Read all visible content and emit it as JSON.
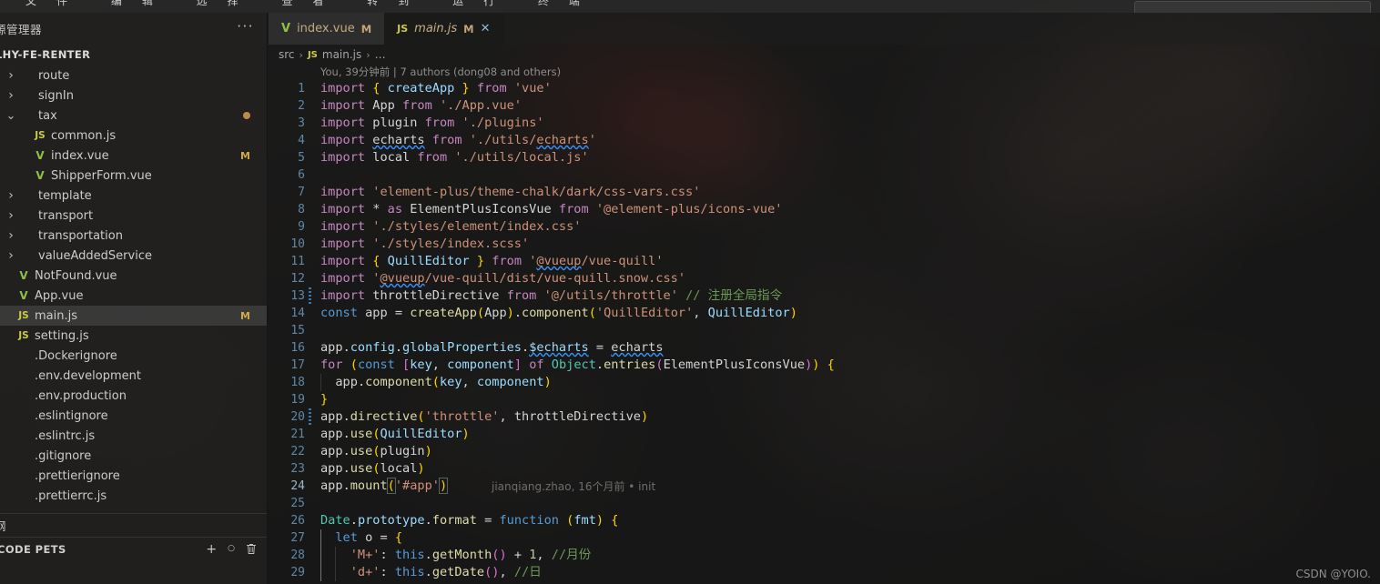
{
  "menubar": {
    "items_cropped": "文件 编辑 选择 查看 转到 运行 终端",
    "search_placeholder": ""
  },
  "sidebar": {
    "title": "源管理器",
    "more_icon": "ellipsis-icon",
    "project": "LHY-FE-RENTER",
    "tree": [
      {
        "label": "route",
        "depth": 1,
        "kind": "folder",
        "chev": "›",
        "icon": "",
        "badge": ""
      },
      {
        "label": "signIn",
        "depth": 1,
        "kind": "folder",
        "chev": "›",
        "icon": "",
        "badge": ""
      },
      {
        "label": "tax",
        "depth": 1,
        "kind": "folder",
        "chev": "⌄",
        "icon": "",
        "badge": "dot"
      },
      {
        "label": "common.js",
        "depth": 2,
        "kind": "js",
        "chev": "",
        "icon": "JS",
        "badge": ""
      },
      {
        "label": "index.vue",
        "depth": 2,
        "kind": "vue",
        "chev": "",
        "icon": "V",
        "badge": "M"
      },
      {
        "label": "ShipperForm.vue",
        "depth": 2,
        "kind": "vue",
        "chev": "",
        "icon": "V",
        "badge": ""
      },
      {
        "label": "template",
        "depth": 1,
        "kind": "folder",
        "chev": "›",
        "icon": "",
        "badge": ""
      },
      {
        "label": "transport",
        "depth": 1,
        "kind": "folder",
        "chev": "›",
        "icon": "",
        "badge": ""
      },
      {
        "label": "transportation",
        "depth": 1,
        "kind": "folder",
        "chev": "›",
        "icon": "",
        "badge": ""
      },
      {
        "label": "valueAddedService",
        "depth": 1,
        "kind": "folder",
        "chev": "›",
        "icon": "",
        "badge": ""
      },
      {
        "label": "NotFound.vue",
        "depth": 0,
        "kind": "vue",
        "chev": "",
        "icon": "V",
        "badge": ""
      },
      {
        "label": "App.vue",
        "depth": 0,
        "kind": "vue",
        "chev": "",
        "icon": "V",
        "badge": ""
      },
      {
        "label": "main.js",
        "depth": 0,
        "kind": "js",
        "chev": "",
        "icon": "JS",
        "badge": "M",
        "selected": true
      },
      {
        "label": "setting.js",
        "depth": 0,
        "kind": "js",
        "chev": "",
        "icon": "JS",
        "badge": ""
      },
      {
        "label": ".Dockerignore",
        "depth": 0,
        "kind": "cfg",
        "chev": "",
        "icon": "",
        "badge": ""
      },
      {
        "label": ".env.development",
        "depth": 0,
        "kind": "cfg",
        "chev": "",
        "icon": "",
        "badge": ""
      },
      {
        "label": ".env.production",
        "depth": 0,
        "kind": "cfg",
        "chev": "",
        "icon": "",
        "badge": ""
      },
      {
        "label": ".eslintignore",
        "depth": 0,
        "kind": "cfg",
        "chev": "",
        "icon": "",
        "badge": ""
      },
      {
        "label": ".eslintrc.js",
        "depth": 0,
        "kind": "cfg",
        "chev": "",
        "icon": "",
        "badge": ""
      },
      {
        "label": ".gitignore",
        "depth": 0,
        "kind": "cfg",
        "chev": "",
        "icon": "",
        "badge": ""
      },
      {
        "label": ".prettierignore",
        "depth": 0,
        "kind": "cfg",
        "chev": "",
        "icon": "",
        "badge": ""
      },
      {
        "label": ".prettierrc.js",
        "depth": 0,
        "kind": "cfg",
        "chev": "",
        "icon": "",
        "badge": ""
      }
    ],
    "outline_panel": {
      "title": "纲"
    },
    "codepets_panel": {
      "title": "CODE PETS",
      "actions": [
        "plus-icon",
        "circle-icon",
        "trash-icon"
      ],
      "action_glyphs": [
        "+",
        "○",
        "🗑"
      ]
    }
  },
  "editor": {
    "tabs": [
      {
        "name": "index.vue",
        "icon": "vue-file-icon",
        "icon_glyph": "V",
        "dirty": "M",
        "state": "inactive",
        "preview": false,
        "closable": false
      },
      {
        "name": "main.js",
        "icon": "js-file-icon",
        "icon_glyph": "JS",
        "dirty": "M",
        "state": "active",
        "preview": true,
        "closable": true,
        "close_glyph": "✕"
      }
    ],
    "breadcrumb": [
      {
        "text": "src",
        "icon": ""
      },
      {
        "text": "main.js",
        "icon": "JS"
      },
      {
        "text": "…",
        "icon": ""
      }
    ],
    "breadcrumb_sep": "›",
    "blame_header": "You, 39分钟前 | 7 authors (dong08 and others)",
    "inline_blame": "jianqiang.zhao, 16个月前 • init",
    "lines": [
      {
        "n": "1",
        "mod": false
      },
      {
        "n": "2",
        "mod": false
      },
      {
        "n": "3",
        "mod": false
      },
      {
        "n": "4",
        "mod": false
      },
      {
        "n": "5",
        "mod": false
      },
      {
        "n": "6",
        "mod": false
      },
      {
        "n": "7",
        "mod": false
      },
      {
        "n": "8",
        "mod": false
      },
      {
        "n": "9",
        "mod": false
      },
      {
        "n": "10",
        "mod": false
      },
      {
        "n": "11",
        "mod": false
      },
      {
        "n": "12",
        "mod": false
      },
      {
        "n": "13",
        "mod": true
      },
      {
        "n": "14",
        "mod": false
      },
      {
        "n": "15",
        "mod": false
      },
      {
        "n": "16",
        "mod": false
      },
      {
        "n": "17",
        "mod": false
      },
      {
        "n": "18",
        "mod": false
      },
      {
        "n": "19",
        "mod": false
      },
      {
        "n": "20",
        "mod": true
      },
      {
        "n": "21",
        "mod": false
      },
      {
        "n": "22",
        "mod": false
      },
      {
        "n": "23",
        "mod": false
      },
      {
        "n": "24",
        "mod": false
      },
      {
        "n": "25",
        "mod": false
      },
      {
        "n": "26",
        "mod": false
      },
      {
        "n": "27",
        "mod": false
      },
      {
        "n": "28",
        "mod": false
      },
      {
        "n": "29",
        "mod": false
      }
    ],
    "source_text": [
      "import { createApp } from 'vue'",
      "import App from './App.vue'",
      "import plugin from './plugins'",
      "import echarts from './utils/echarts'",
      "import local from './utils/local.js'",
      "",
      "import 'element-plus/theme-chalk/dark/css-vars.css'",
      "import * as ElementPlusIconsVue from '@element-plus/icons-vue'",
      "import './styles/element/index.css'",
      "import './styles/index.scss'",
      "import { QuillEditor } from '@vueup/vue-quill'",
      "import '@vueup/vue-quill/dist/vue-quill.snow.css'",
      "import throttleDirective from '@/utils/throttle' // 注册全局指令",
      "const app = createApp(App).component('QuillEditor', QuillEditor)",
      "",
      "app.config.globalProperties.$echarts = echarts",
      "for (const [key, component] of Object.entries(ElementPlusIconsVue)) {",
      "  app.component(key, component)",
      "}",
      "app.directive('throttle', throttleDirective)",
      "app.use(QuillEditor)",
      "app.use(plugin)",
      "app.use(local)",
      "app.mount('#app')",
      "",
      "Date.prototype.format = function (fmt) {",
      "  let o = {",
      "    'M+': this.getMonth() + 1, //月份",
      "    'd+': this.getDate(), //日"
    ]
  },
  "watermark": "CSDN @YOIO.",
  "colors": {
    "editor_bg": "#1e1e1e",
    "sidebar_bg": "#232221",
    "accent_blue": "#569cd6",
    "string": "#ce9178",
    "comment": "#6a9955",
    "function": "#dcdcaa",
    "variable": "#9cdcfe",
    "class": "#4ec9b0",
    "keyword_ctrl": "#c586c0",
    "line_number": "#5f87a8",
    "modified_badge": "#d6a849",
    "vue_icon": "#8dc149",
    "js_icon": "#cbcb41"
  }
}
